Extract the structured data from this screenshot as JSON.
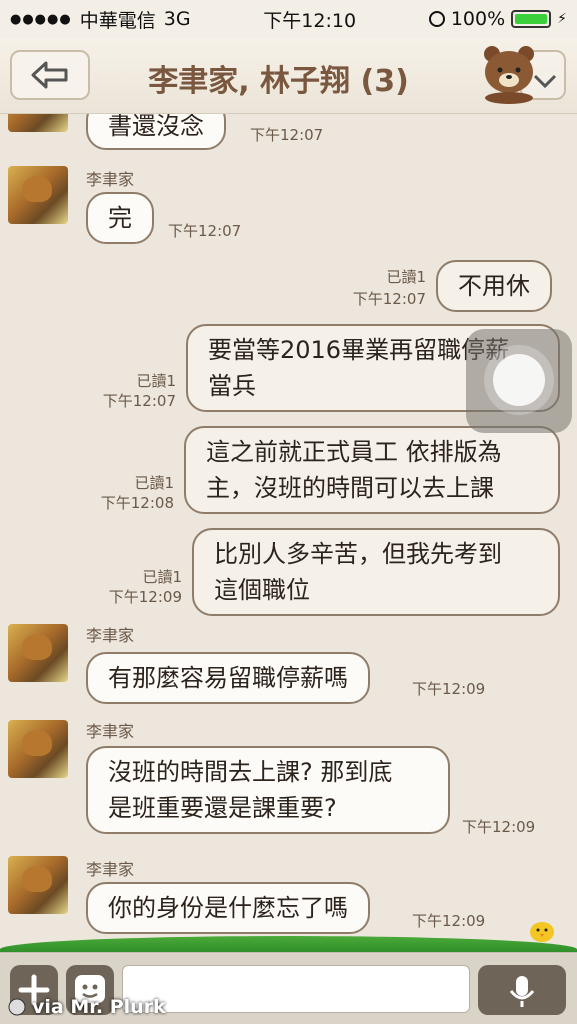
{
  "status_bar": {
    "carrier": "中華電信",
    "network": "3G",
    "time": "下午12:10",
    "battery": "100%",
    "battery_level": 1.0
  },
  "nav": {
    "title": "李聿家, 林子翔 (3)"
  },
  "messages": [
    {
      "text": "書還沒念",
      "time": "下午12:07"
    },
    {
      "sender": "李聿家",
      "text": "完",
      "time": "下午12:07"
    },
    {
      "read": "已讀1",
      "text": "不用休",
      "time": "下午12:07"
    },
    {
      "read": "已讀1",
      "line1": "要當等2016畢業再留職停薪",
      "line2": "當兵",
      "time": "下午12:07"
    },
    {
      "read": "已讀1",
      "line1": "這之前就正式員工 依排版為",
      "line2": "主，沒班的時間可以去上課",
      "time": "下午12:08"
    },
    {
      "read": "已讀1",
      "line1": "比別人多辛苦，但我先考到",
      "line2": "這個職位",
      "time": "下午12:09"
    },
    {
      "sender": "李聿家",
      "text": "有那麼容易留職停薪嗎",
      "time": "下午12:09"
    },
    {
      "sender": "李聿家",
      "line1": "沒班的時間去上課? 那到底",
      "line2": "是班重要還是課重要?",
      "time": "下午12:09"
    },
    {
      "sender": "李聿家",
      "text": "你的身份是什麼忘了嗎",
      "time": "下午12:09"
    }
  ],
  "input": {
    "value": ""
  },
  "watermark": "via Mr. Plurk",
  "colors": {
    "accent": "#7a5840",
    "background": "#ece6dc",
    "battery": "#3ccf3c"
  }
}
